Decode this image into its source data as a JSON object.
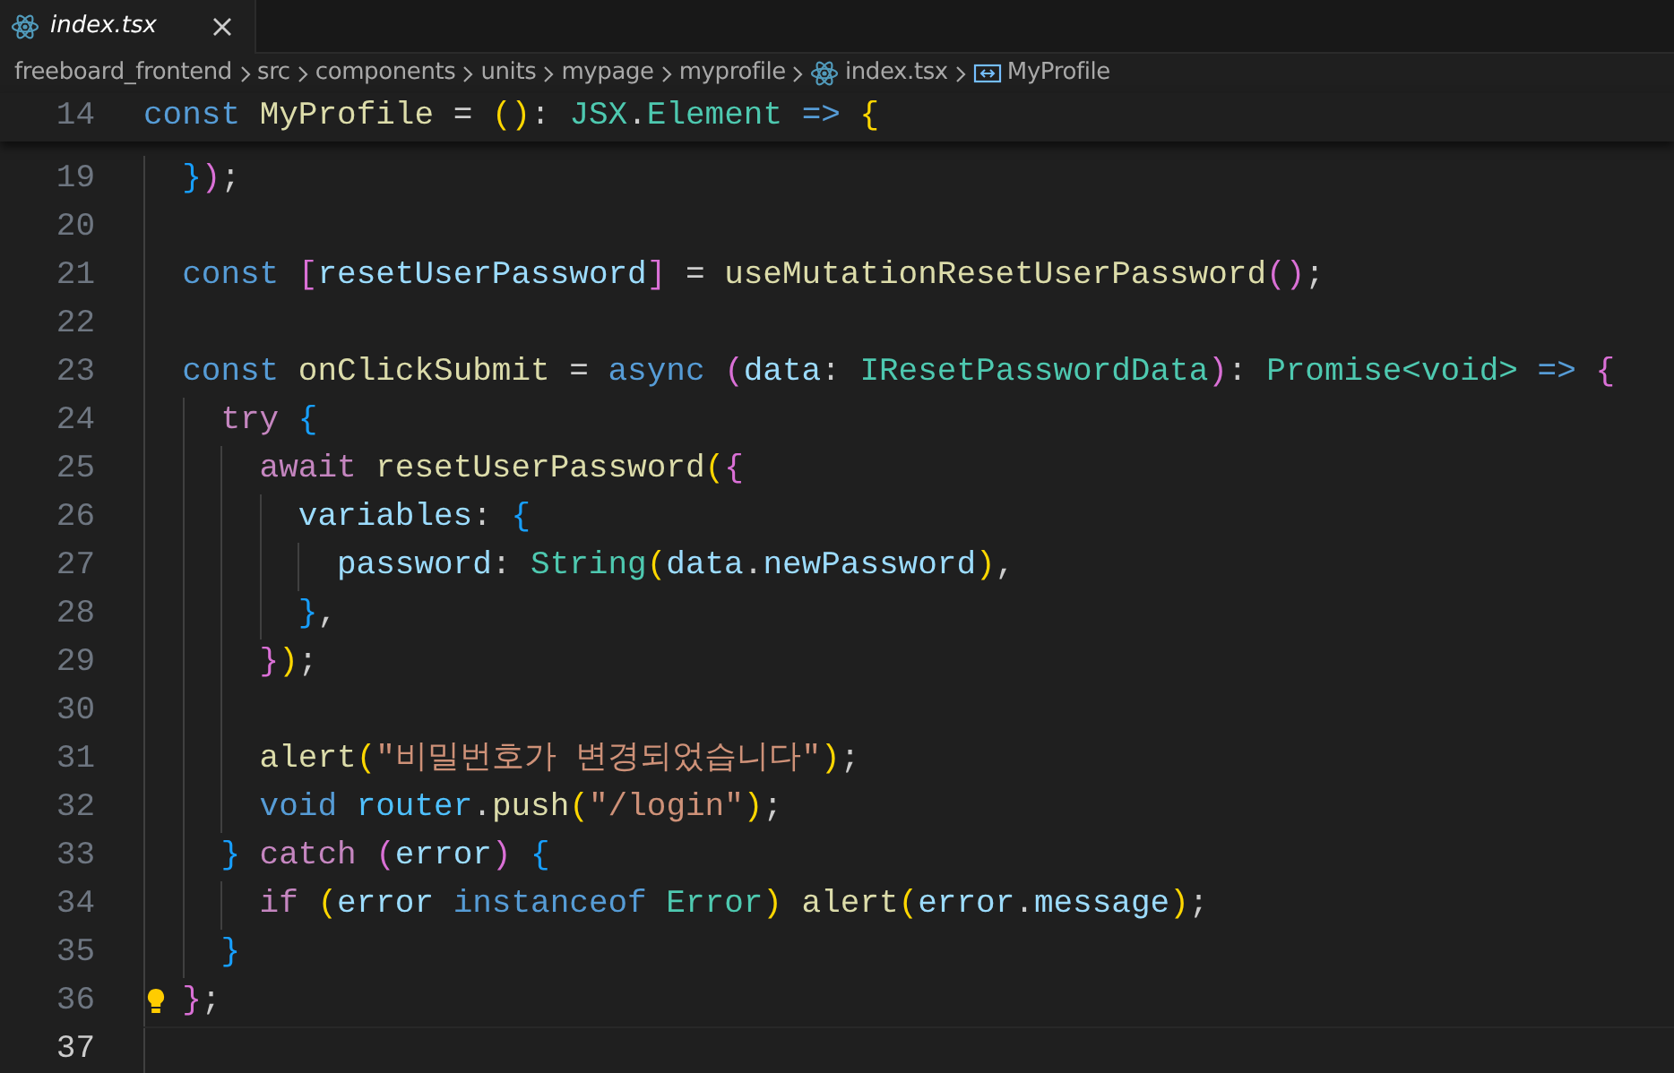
{
  "tabs": [
    {
      "label": "index.tsx",
      "selected": true,
      "preview": true
    }
  ],
  "breadcrumb": [
    {
      "label": "freeboard_frontend",
      "kind": "folder"
    },
    {
      "label": "src",
      "kind": "folder"
    },
    {
      "label": "components",
      "kind": "folder"
    },
    {
      "label": "units",
      "kind": "folder"
    },
    {
      "label": "mypage",
      "kind": "folder"
    },
    {
      "label": "myprofile",
      "kind": "folder"
    },
    {
      "label": "index.tsx",
      "kind": "file"
    },
    {
      "label": "MyProfile",
      "kind": "symbol"
    }
  ],
  "sticky_line": {
    "number": "14",
    "tokens": [
      {
        "text": "const",
        "kind": "kw"
      },
      {
        "text": " MyProfile",
        "kind": "fn"
      },
      {
        "text": " = ",
        "kind": "punc"
      },
      {
        "text": "(",
        "kind": "b1"
      },
      {
        "text": ")",
        "kind": "b1"
      },
      {
        "text": ": ",
        "kind": "punc"
      },
      {
        "text": "JSX",
        "kind": "type"
      },
      {
        "text": ".",
        "kind": "punc"
      },
      {
        "text": "Element",
        "kind": "type"
      },
      {
        "text": " =>",
        "kind": "kw"
      },
      {
        "text": " {",
        "kind": "b1"
      }
    ]
  },
  "lines": [
    {
      "number": "19",
      "current": false,
      "lightbulb": false,
      "tokens": [
        {
          "text": "  }",
          "kind": "b3"
        },
        {
          "text": ")",
          "kind": "b2"
        },
        {
          "text": ";",
          "kind": "punc"
        }
      ]
    },
    {
      "number": "20",
      "current": false,
      "lightbulb": false
    },
    {
      "number": "21",
      "current": false,
      "lightbulb": false,
      "tokens": [
        {
          "text": "  const",
          "kind": "kw"
        },
        {
          "text": " [",
          "kind": "b2"
        },
        {
          "text": "resetUserPassword",
          "kind": "var"
        },
        {
          "text": "]",
          "kind": "b2"
        },
        {
          "text": " = ",
          "kind": "punc"
        },
        {
          "text": "useMutationResetUserPassword",
          "kind": "fn"
        },
        {
          "text": "()",
          "kind": "b2"
        },
        {
          "text": ";",
          "kind": "punc"
        }
      ]
    },
    {
      "number": "22",
      "current": false,
      "lightbulb": false
    },
    {
      "number": "23",
      "current": false,
      "lightbulb": false,
      "tokens": [
        {
          "text": "  const",
          "kind": "kw"
        },
        {
          "text": " onClickSubmit",
          "kind": "fn"
        },
        {
          "text": " = ",
          "kind": "punc"
        },
        {
          "text": "async",
          "kind": "kw"
        },
        {
          "text": " (",
          "kind": "b2"
        },
        {
          "text": "data",
          "kind": "var"
        },
        {
          "text": ": ",
          "kind": "punc"
        },
        {
          "text": "IResetPasswordData",
          "kind": "type"
        },
        {
          "text": ")",
          "kind": "b2"
        },
        {
          "text": ": ",
          "kind": "punc"
        },
        {
          "text": "Promise<void>",
          "kind": "type"
        },
        {
          "text": " =>",
          "kind": "kw"
        },
        {
          "text": " {",
          "kind": "b2"
        }
      ]
    },
    {
      "number": "24",
      "current": false,
      "lightbulb": false,
      "tokens": [
        {
          "text": "    try",
          "kind": "ctl"
        },
        {
          "text": " {",
          "kind": "b3"
        }
      ]
    },
    {
      "number": "25",
      "current": false,
      "lightbulb": false,
      "tokens": [
        {
          "text": "      await",
          "kind": "ctl"
        },
        {
          "text": " resetUserPassword",
          "kind": "fn"
        },
        {
          "text": "(",
          "kind": "b1"
        },
        {
          "text": "{",
          "kind": "b2"
        }
      ]
    },
    {
      "number": "26",
      "current": false,
      "lightbulb": false,
      "tokens": [
        {
          "text": "        variables",
          "kind": "var"
        },
        {
          "text": ": ",
          "kind": "punc"
        },
        {
          "text": "{",
          "kind": "b3"
        }
      ]
    },
    {
      "number": "27",
      "current": false,
      "lightbulb": false,
      "tokens": [
        {
          "text": "          password",
          "kind": "var"
        },
        {
          "text": ": ",
          "kind": "punc"
        },
        {
          "text": "String",
          "kind": "type"
        },
        {
          "text": "(",
          "kind": "b1"
        },
        {
          "text": "data",
          "kind": "var"
        },
        {
          "text": ".",
          "kind": "punc"
        },
        {
          "text": "newPassword",
          "kind": "var"
        },
        {
          "text": ")",
          "kind": "b1"
        },
        {
          "text": ",",
          "kind": "punc"
        }
      ]
    },
    {
      "number": "28",
      "current": false,
      "lightbulb": false,
      "tokens": [
        {
          "text": "        }",
          "kind": "b3"
        },
        {
          "text": ",",
          "kind": "punc"
        }
      ]
    },
    {
      "number": "29",
      "current": false,
      "lightbulb": false,
      "tokens": [
        {
          "text": "      }",
          "kind": "b2"
        },
        {
          "text": ")",
          "kind": "b1"
        },
        {
          "text": ";",
          "kind": "punc"
        }
      ]
    },
    {
      "number": "30",
      "current": false,
      "lightbulb": false
    },
    {
      "number": "31",
      "current": false,
      "lightbulb": false,
      "tokens": [
        {
          "text": "      alert",
          "kind": "fn"
        },
        {
          "text": "(",
          "kind": "b1"
        },
        {
          "text": "\"비밀번호가 변경되었습니다\"",
          "kind": "str"
        },
        {
          "text": ")",
          "kind": "b1"
        },
        {
          "text": ";",
          "kind": "punc"
        }
      ]
    },
    {
      "number": "32",
      "current": false,
      "lightbulb": false,
      "tokens": [
        {
          "text": "      void",
          "kind": "kw"
        },
        {
          "text": " router",
          "kind": "const"
        },
        {
          "text": ".",
          "kind": "punc"
        },
        {
          "text": "push",
          "kind": "fn"
        },
        {
          "text": "(",
          "kind": "b1"
        },
        {
          "text": "\"/login\"",
          "kind": "str"
        },
        {
          "text": ")",
          "kind": "b1"
        },
        {
          "text": ";",
          "kind": "punc"
        }
      ]
    },
    {
      "number": "33",
      "current": false,
      "lightbulb": false,
      "tokens": [
        {
          "text": "    }",
          "kind": "b3"
        },
        {
          "text": " catch",
          "kind": "ctl"
        },
        {
          "text": " (",
          "kind": "b2"
        },
        {
          "text": "error",
          "kind": "var"
        },
        {
          "text": ")",
          "kind": "b2"
        },
        {
          "text": " {",
          "kind": "b3"
        }
      ]
    },
    {
      "number": "34",
      "current": false,
      "lightbulb": false,
      "tokens": [
        {
          "text": "      if",
          "kind": "ctl"
        },
        {
          "text": " (",
          "kind": "b1"
        },
        {
          "text": "error",
          "kind": "var"
        },
        {
          "text": " instanceof",
          "kind": "kw"
        },
        {
          "text": " Error",
          "kind": "type"
        },
        {
          "text": ")",
          "kind": "b1"
        },
        {
          "text": " alert",
          "kind": "fn"
        },
        {
          "text": "(",
          "kind": "b1"
        },
        {
          "text": "error",
          "kind": "var"
        },
        {
          "text": ".",
          "kind": "punc"
        },
        {
          "text": "message",
          "kind": "var"
        },
        {
          "text": ")",
          "kind": "b1"
        },
        {
          "text": ";",
          "kind": "punc"
        }
      ]
    },
    {
      "number": "35",
      "current": false,
      "lightbulb": false,
      "tokens": [
        {
          "text": "    }",
          "kind": "b3"
        }
      ]
    },
    {
      "number": "36",
      "current": false,
      "lightbulb": true,
      "tokens": [
        {
          "text": "  }",
          "kind": "b2"
        },
        {
          "text": ";",
          "kind": "punc"
        }
      ]
    },
    {
      "number": "37",
      "current": true,
      "lightbulb": false
    }
  ]
}
